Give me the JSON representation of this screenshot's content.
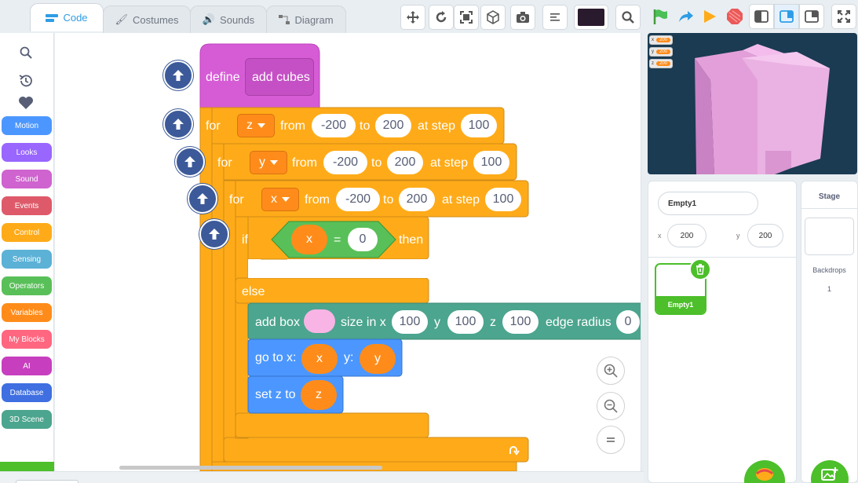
{
  "tabs": [
    {
      "label": "Code",
      "icon": "code-icon"
    },
    {
      "label": "Costumes",
      "icon": "brush-icon"
    },
    {
      "label": "Sounds",
      "icon": "speaker-icon"
    },
    {
      "label": "Diagram",
      "icon": "diagram-icon"
    }
  ],
  "toolbar": {
    "buttons": [
      "move-icon",
      "redo-icon",
      "fit-icon",
      "cube-icon",
      "camera-icon",
      "align-icon"
    ],
    "color": "#2a1a2e",
    "search_icon": "search-icon"
  },
  "stage_controls": [
    "green-flag-icon",
    "turbo-icon",
    "play-icon",
    "stop-icon",
    "small-stage-icon",
    "normal-stage-icon",
    "split-stage-icon",
    "fullscreen-icon"
  ],
  "palette": {
    "top_icons": [
      "search-icon",
      "history-icon",
      "heart-icon"
    ],
    "categories": [
      {
        "label": "Motion",
        "color": "#4c97ff"
      },
      {
        "label": "Looks",
        "color": "#9966ff"
      },
      {
        "label": "Sound",
        "color": "#cf63cf"
      },
      {
        "label": "Events",
        "color": "#de5a6a"
      },
      {
        "label": "Control",
        "color": "#ffab19"
      },
      {
        "label": "Sensing",
        "color": "#5cb1d6"
      },
      {
        "label": "Operators",
        "color": "#59c059"
      },
      {
        "label": "Variables",
        "color": "#ff8c1a"
      },
      {
        "label": "My Blocks",
        "color": "#ff6680"
      },
      {
        "label": "AI",
        "color": "#c73fbf"
      },
      {
        "label": "Database",
        "color": "#3f6fe0"
      },
      {
        "label": "3D Scene",
        "color": "#4ca58e"
      }
    ],
    "extension_icon": "add-extension-icon"
  },
  "script": {
    "define": {
      "keyword": "define",
      "name": "add cubes"
    },
    "loops": [
      {
        "keyword": "for",
        "var": "z",
        "from_label": "from",
        "from": "-200",
        "to_label": "to",
        "to": "200",
        "step_label": "at step",
        "step": "100"
      },
      {
        "keyword": "for",
        "var": "y",
        "from_label": "from",
        "from": "-200",
        "to_label": "to",
        "to": "200",
        "step_label": "at step",
        "step": "100"
      },
      {
        "keyword": "for",
        "var": "x",
        "from_label": "from",
        "from": "-200",
        "to_label": "to",
        "to": "200",
        "step_label": "at step",
        "step": "100"
      }
    ],
    "if_block": {
      "keyword": "if",
      "left": "x",
      "op": "=",
      "right": "0",
      "then": "then",
      "else": "else"
    },
    "add_box": {
      "label": "add box",
      "size_label": "size in x",
      "sx": "100",
      "y_label": "y",
      "sy": "100",
      "z_label": "z",
      "sz": "100",
      "edge_label": "edge radius",
      "edge": "0",
      "color": "#f9b4e6"
    },
    "goto": {
      "label": "go to x:",
      "x": "x",
      "y_label": "y:",
      "y": "y"
    },
    "setz": {
      "label": "set z to",
      "value": "z"
    }
  },
  "zoom": [
    "zoom-in-icon",
    "zoom-out-icon",
    "zoom-reset-icon"
  ],
  "stage": {
    "monitors": [
      {
        "name": "x",
        "value": "200"
      },
      {
        "name": "y",
        "value": "200"
      },
      {
        "name": "z",
        "value": "200"
      }
    ]
  },
  "sprite_info": {
    "name": "Empty1",
    "x_label": "x",
    "x": "200",
    "y_label": "y",
    "y": "200"
  },
  "sprites": [
    {
      "name": "Empty1",
      "selected": true
    }
  ],
  "stage_panel": {
    "title": "Stage",
    "backdrops_label": "Backdrops",
    "backdrops_count": "1"
  }
}
